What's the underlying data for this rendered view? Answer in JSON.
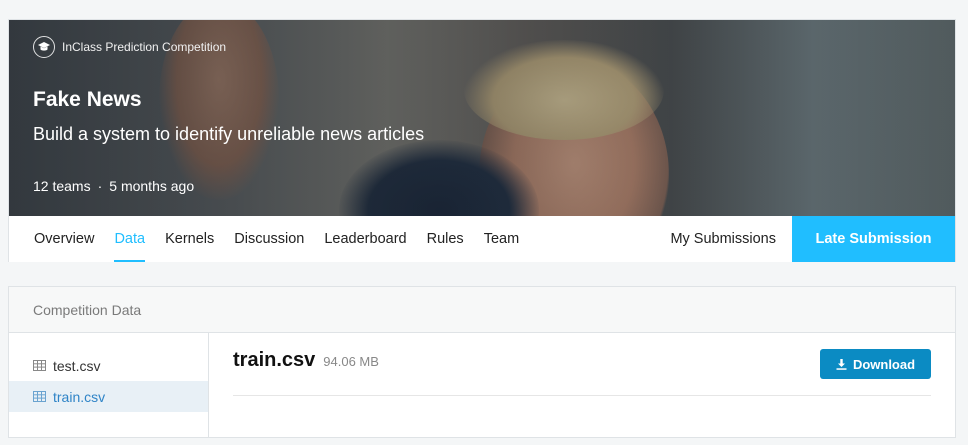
{
  "competition": {
    "badge": "InClass Prediction Competition",
    "title": "Fake News",
    "subtitle": "Build a system to identify unreliable news articles",
    "teams": "12 teams",
    "separator": "·",
    "age": "5 months ago"
  },
  "tabs": [
    {
      "label": "Overview",
      "active": false
    },
    {
      "label": "Data",
      "active": true
    },
    {
      "label": "Kernels",
      "active": false
    },
    {
      "label": "Discussion",
      "active": false
    },
    {
      "label": "Leaderboard",
      "active": false
    },
    {
      "label": "Rules",
      "active": false
    },
    {
      "label": "Team",
      "active": false
    }
  ],
  "actions": {
    "my_submissions": "My Submissions",
    "late_submission": "Late Submission"
  },
  "data_section": {
    "header": "Competition Data",
    "files": [
      {
        "name": "test.csv",
        "selected": false,
        "icon": "table-icon"
      },
      {
        "name": "train.csv",
        "selected": true,
        "icon": "table-icon"
      }
    ],
    "selected_file": {
      "name": "train.csv",
      "size": "94.06 MB",
      "download_label": "Download"
    }
  },
  "colors": {
    "accent": "#20beff",
    "download": "#0b8bc3",
    "selected_file_text": "#2f84c7",
    "selected_file_bg": "#e8f0f6"
  }
}
